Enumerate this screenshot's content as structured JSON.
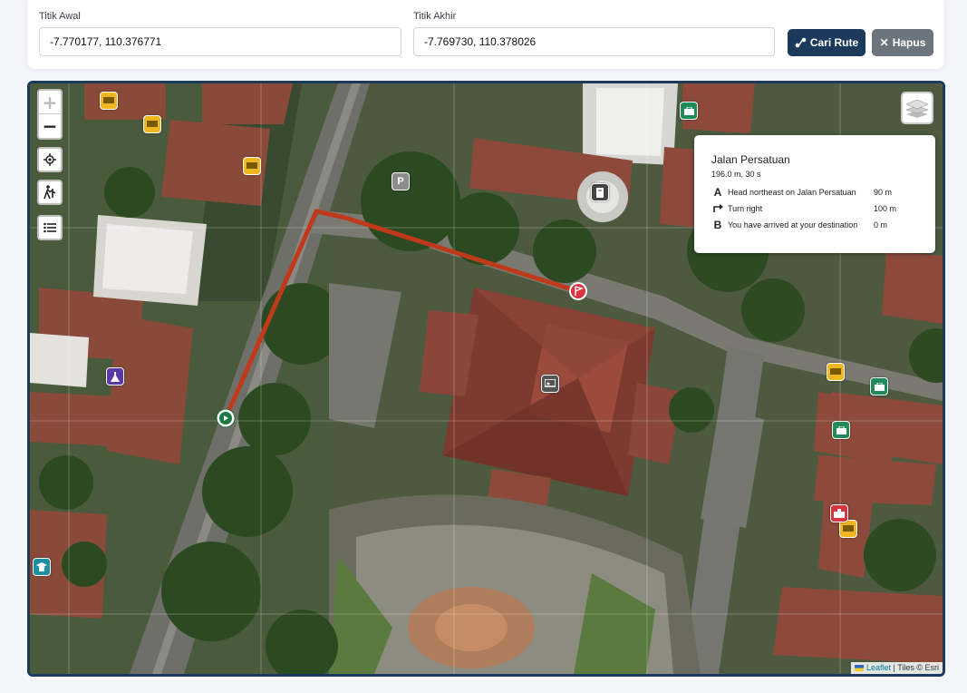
{
  "form": {
    "start_label": "Titik Awal",
    "start_value": "-7.770177, 110.376771",
    "end_label": "Titik Akhir",
    "end_value": "-7.769730, 110.378026",
    "search_label": "Cari Rute",
    "clear_label": "Hapus"
  },
  "map": {
    "zoom_in": "+",
    "zoom_out": "−",
    "route_color": "#c0391b",
    "frame_color": "#1b3a5c",
    "start_marker_icon": "play-icon",
    "end_marker_icon": "flag-icon",
    "controls": [
      "locate-icon",
      "person-walking-icon",
      "list-icon",
      "layers-icon"
    ],
    "poi_icons": [
      "bus-icon",
      "briefcase-icon",
      "parking-icon",
      "book-icon",
      "flask-icon",
      "presentation-icon",
      "school-icon",
      "hospital-icon"
    ]
  },
  "itinerary": {
    "title": "Jalan Persatuan",
    "summary": "196.0 m, 30 s",
    "steps": [
      {
        "icon": "A",
        "text": "Head northeast on Jalan Persatuan",
        "distance": "90 m"
      },
      {
        "icon": "turn-right-icon",
        "text": "Turn right",
        "distance": "100 m"
      },
      {
        "icon": "B",
        "text": "You have arrived at your destination",
        "distance": "0 m"
      }
    ]
  },
  "attribution": {
    "leaflet": "Leaflet",
    "tiles": "| Tiles © Esri"
  }
}
